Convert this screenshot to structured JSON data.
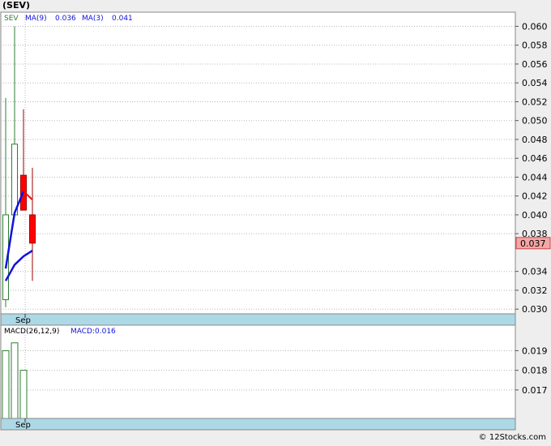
{
  "ticker_title": "(SEV)",
  "credit": "© 12Stocks.com",
  "colors": {
    "up": "#2e7d32",
    "down": "#ff0000",
    "ma": "#1111dd",
    "axis_band": "#add8e6",
    "last_price_bg": "#f4a6a6",
    "grid": "#b8b8b8"
  },
  "chart_data": [
    {
      "type": "candlestick",
      "legend": {
        "ticker": "SEV",
        "ma9": "MA(9)",
        "ma9_value": "0.036",
        "ma3": "MA(3)",
        "ma3_value": "0.041"
      },
      "x_tick": "Sep",
      "ylim": [
        0.0295,
        0.0615
      ],
      "y_ticks": [
        "0.060",
        "0.058",
        "0.056",
        "0.054",
        "0.052",
        "0.050",
        "0.048",
        "0.046",
        "0.044",
        "0.042",
        "0.040",
        "0.038",
        "0.034",
        "0.032",
        "0.030"
      ],
      "last_price": "0.037",
      "last_price_value": 0.037,
      "candles": [
        {
          "open": 0.031,
          "close": 0.04,
          "high": 0.0524,
          "low": 0.0302,
          "dir": "up"
        },
        {
          "open": 0.04,
          "close": 0.0475,
          "high": 0.06,
          "low": 0.04,
          "dir": "up"
        },
        {
          "open": 0.0442,
          "close": 0.0405,
          "high": 0.0512,
          "low": 0.0405,
          "dir": "down"
        },
        {
          "open": 0.04,
          "close": 0.037,
          "high": 0.045,
          "low": 0.033,
          "dir": "down"
        }
      ],
      "ma_lines": [
        {
          "name": "MA(3)",
          "points": [
            0.0343,
            0.0402,
            0.0425,
            0.0416
          ]
        },
        {
          "name": "MA(9)",
          "points": [
            0.033,
            0.0347,
            0.0356,
            0.0362
          ]
        }
      ]
    },
    {
      "type": "bar",
      "legend": {
        "macd": "MACD(26,12,9)",
        "macd_value_label": "MACD:0.016"
      },
      "x_tick": "Sep",
      "ylim": [
        0.01555,
        0.0203
      ],
      "y_ticks": [
        "0.019",
        "0.018",
        "0.017"
      ],
      "values": [
        0.019,
        0.0194,
        0.018
      ]
    }
  ]
}
